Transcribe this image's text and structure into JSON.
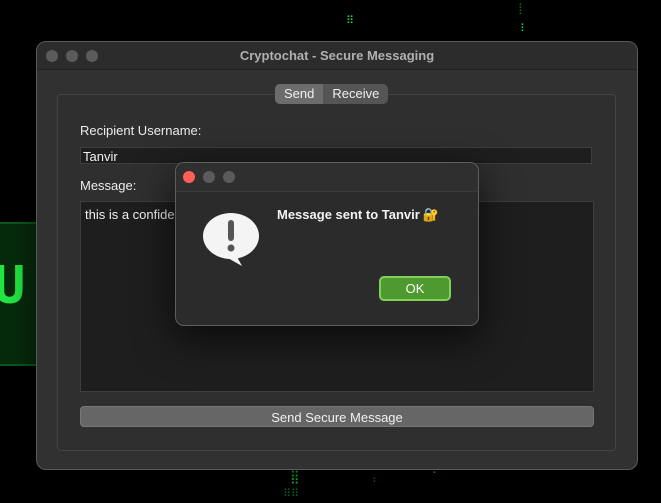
{
  "window": {
    "title": "Cryptochat - Secure Messaging"
  },
  "tabs": [
    {
      "label": "Send",
      "active": true
    },
    {
      "label": "Receive",
      "active": false
    }
  ],
  "form": {
    "recipient_label": "Recipient Username:",
    "recipient_value": "Tanvir",
    "message_label": "Message:",
    "message_value": "this is a confide",
    "send_button": "Send Secure Message"
  },
  "dialog": {
    "message": "Message sent to Tanvir",
    "icon": "alert-caution-icon",
    "lock_icon": "🔐",
    "ok_label": "OK"
  },
  "colors": {
    "accent_ok": "#4e9a2e",
    "close_red": "#fe5f57",
    "matrix_green": "#1fd23a"
  }
}
